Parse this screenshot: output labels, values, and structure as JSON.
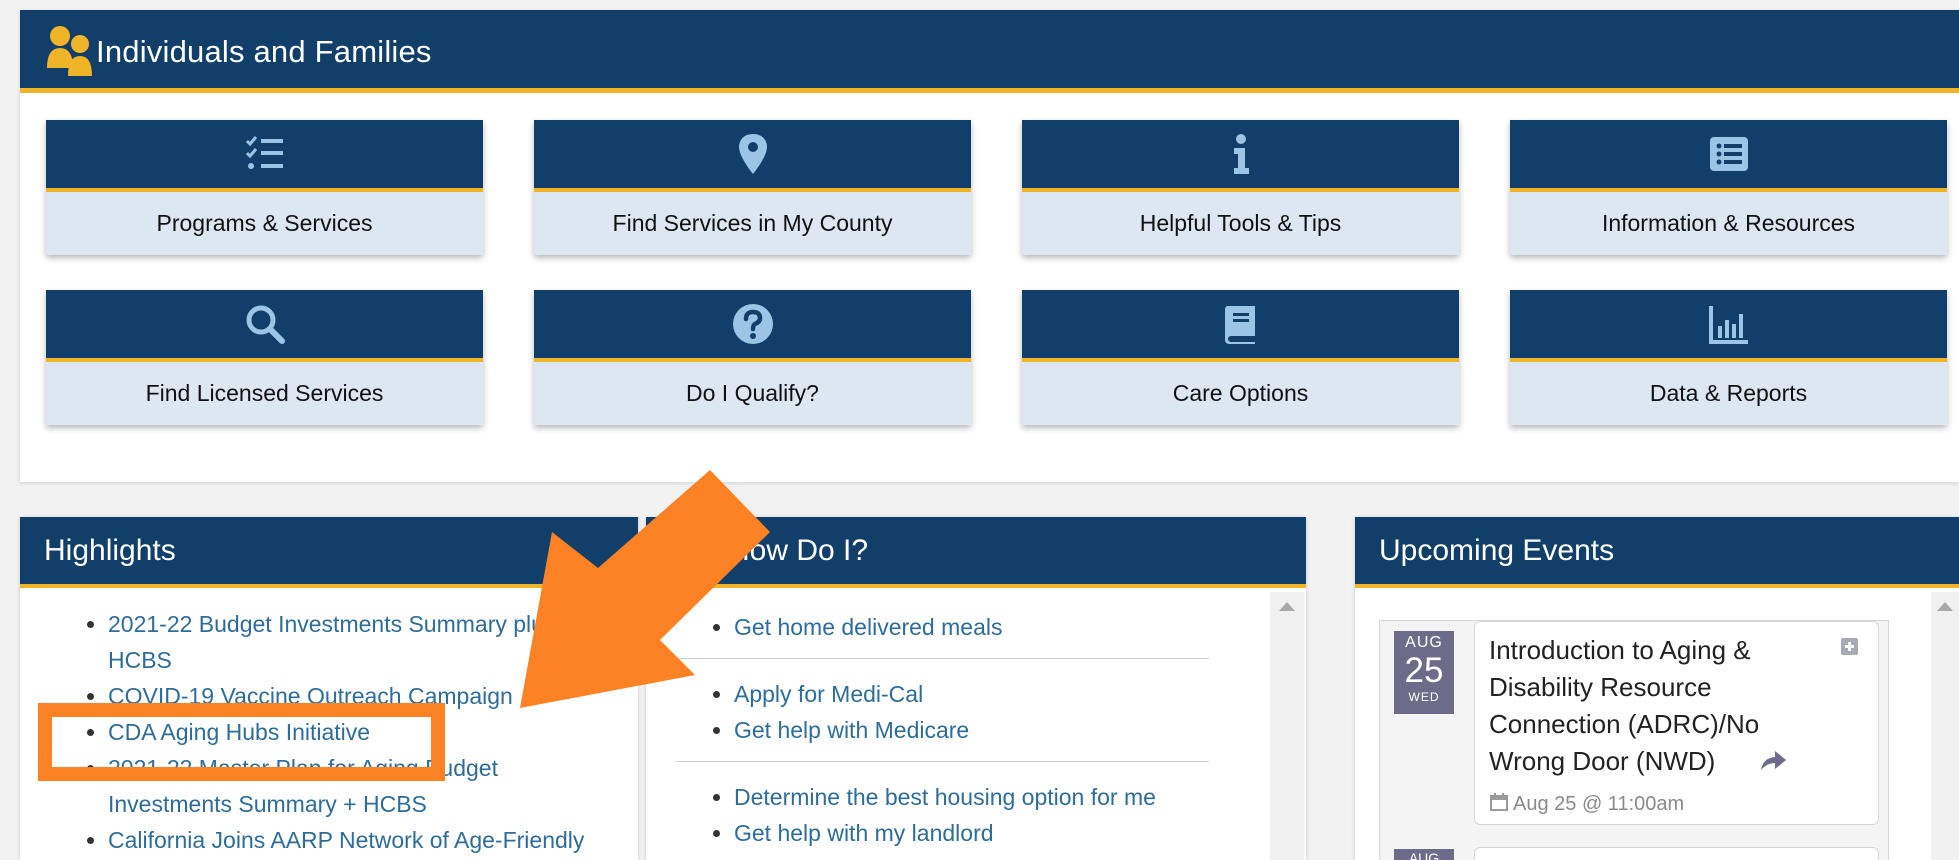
{
  "top": {
    "title": "Individuals and Families",
    "tiles": [
      {
        "label": "Programs & Services",
        "icon": "checklist-icon"
      },
      {
        "label": "Find Services in My County",
        "icon": "map-pin-icon"
      },
      {
        "label": "Helpful Tools & Tips",
        "icon": "info-icon"
      },
      {
        "label": "Information & Resources",
        "icon": "list-alt-icon"
      },
      {
        "label": "Find Licensed Services",
        "icon": "search-icon"
      },
      {
        "label": "Do I Qualify?",
        "icon": "question-circle-icon"
      },
      {
        "label": "Care Options",
        "icon": "book-icon"
      },
      {
        "label": "Data & Reports",
        "icon": "bar-chart-icon"
      }
    ]
  },
  "highlights": {
    "title": "Highlights",
    "items": [
      "2021-22 Budget Investments Summary plus HCBS",
      "COVID-19 Vaccine Outreach Campaign",
      "CDA Aging Hubs Initiative",
      "2021-22 Master Plan for Aging Budget Investments Summary + HCBS",
      "California Joins AARP Network of Age-Friendly"
    ]
  },
  "howdoi": {
    "title": "How Do I?",
    "groups": [
      [
        "Get home delivered meals"
      ],
      [
        "Apply for Medi-Cal",
        "Get help with Medicare"
      ],
      [
        "Determine the best housing option for me",
        "Get help with my landlord"
      ]
    ]
  },
  "events": {
    "title": "Upcoming Events",
    "items": [
      {
        "month": "AUG",
        "day": "25",
        "weekday": "WED",
        "title": "Introduction to Aging & Disability Resource Connection (ADRC)/No Wrong Door (NWD)",
        "time": "Aug 25 @ 11:00am"
      },
      {
        "month": "AUG"
      }
    ]
  },
  "colors": {
    "navy": "#123f6a",
    "gold": "#f0b429",
    "tile_light": "#dce7f1",
    "link": "#2e6d99",
    "annotation": "#fd8224"
  }
}
